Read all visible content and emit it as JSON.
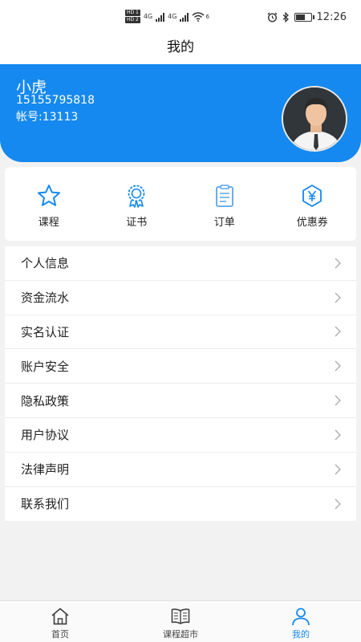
{
  "status_bar": {
    "hd1": "HD 1",
    "hd2": "HD 2",
    "net1": "4G",
    "net2": "4G",
    "wifi_label": "6",
    "time": "12:26",
    "icons": [
      "alarm-icon",
      "bluetooth-icon",
      "battery-icon"
    ]
  },
  "page_title": "我的",
  "profile": {
    "name": "小虎",
    "phone": "15155795818",
    "account": "帐号:13113"
  },
  "quick_actions": [
    {
      "label": "课程",
      "icon": "star-icon"
    },
    {
      "label": "证书",
      "icon": "certificate-icon"
    },
    {
      "label": "订单",
      "icon": "clipboard-icon"
    },
    {
      "label": "优惠券",
      "icon": "yen-coupon-icon"
    }
  ],
  "menu": [
    {
      "label": "个人信息"
    },
    {
      "label": "资金流水"
    },
    {
      "label": "实名认证"
    },
    {
      "label": "账户安全"
    },
    {
      "label": "隐私政策"
    },
    {
      "label": "用户协议"
    },
    {
      "label": "法律声明"
    },
    {
      "label": "联系我们"
    }
  ],
  "tabs": [
    {
      "label": "首页",
      "icon": "home-icon",
      "active": false
    },
    {
      "label": "课程超市",
      "icon": "book-icon",
      "active": false
    },
    {
      "label": "我的",
      "icon": "user-icon",
      "active": true
    }
  ],
  "colors": {
    "accent": "#1589ef",
    "background": "#f2f2f2"
  }
}
